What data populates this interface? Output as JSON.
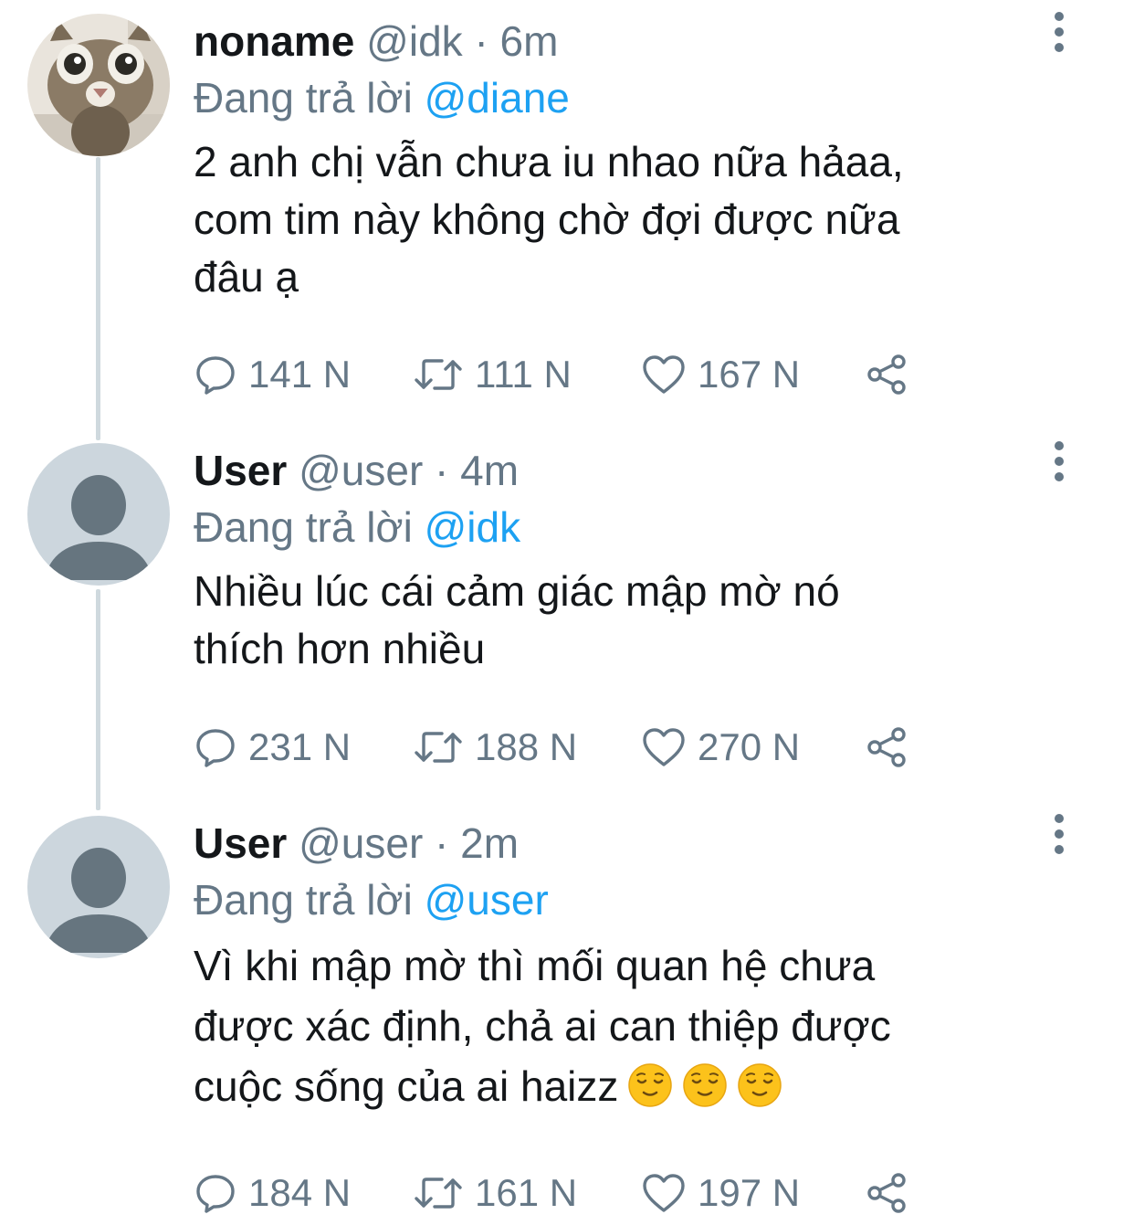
{
  "colors": {
    "text": "#14171a",
    "muted": "#657786",
    "link": "#1da1f2",
    "thread_line": "#cfd9de",
    "default_avatar_bg": "#ccd6dd",
    "default_avatar_fg": "#66757f"
  },
  "tweets": [
    {
      "display_name": "noname",
      "handle": "@idk",
      "dot": "·",
      "time": "6m",
      "reply_prefix": "Đang trả lời",
      "reply_to": "@diane",
      "text": "2 anh chị vẫn chưa iu nhao nữa hảaa,\ncom tim này không chờ đợi được nữa\nđâu ạ",
      "avatar": "cat-photo",
      "stats": {
        "replies": "141 N",
        "retweets": "111 N",
        "likes": "167 N"
      }
    },
    {
      "display_name": "User",
      "handle": "@user",
      "dot": "·",
      "time": "4m",
      "reply_prefix": "Đang trả lời",
      "reply_to": "@idk",
      "text": "Nhiều lúc cái cảm giác mập mờ nó\nthích hơn nhiều",
      "avatar": "default-user-avatar",
      "stats": {
        "replies": "231 N",
        "retweets": "188 N",
        "likes": "270 N"
      }
    },
    {
      "display_name": "User",
      "handle": "@user",
      "dot": "·",
      "time": "2m",
      "reply_prefix": "Đang trả lời",
      "reply_to": "@user",
      "text": "Vì khi mập mờ thì mối quan hệ chưa\nđược xác định, chả ai can thiệp được\ncuộc sống của ai haizz",
      "emojis": [
        "relieved-face-emoji",
        "relieved-face-emoji",
        "relieved-face-emoji"
      ],
      "avatar": "default-user-avatar",
      "stats": {
        "replies": "184 N",
        "retweets": "161 N",
        "likes": "197 N"
      }
    }
  ],
  "icons": {
    "reply": "reply-bubble-icon",
    "retweet": "retweet-icon",
    "like": "heart-icon",
    "share": "share-icon",
    "more": "more-vertical-icon"
  }
}
